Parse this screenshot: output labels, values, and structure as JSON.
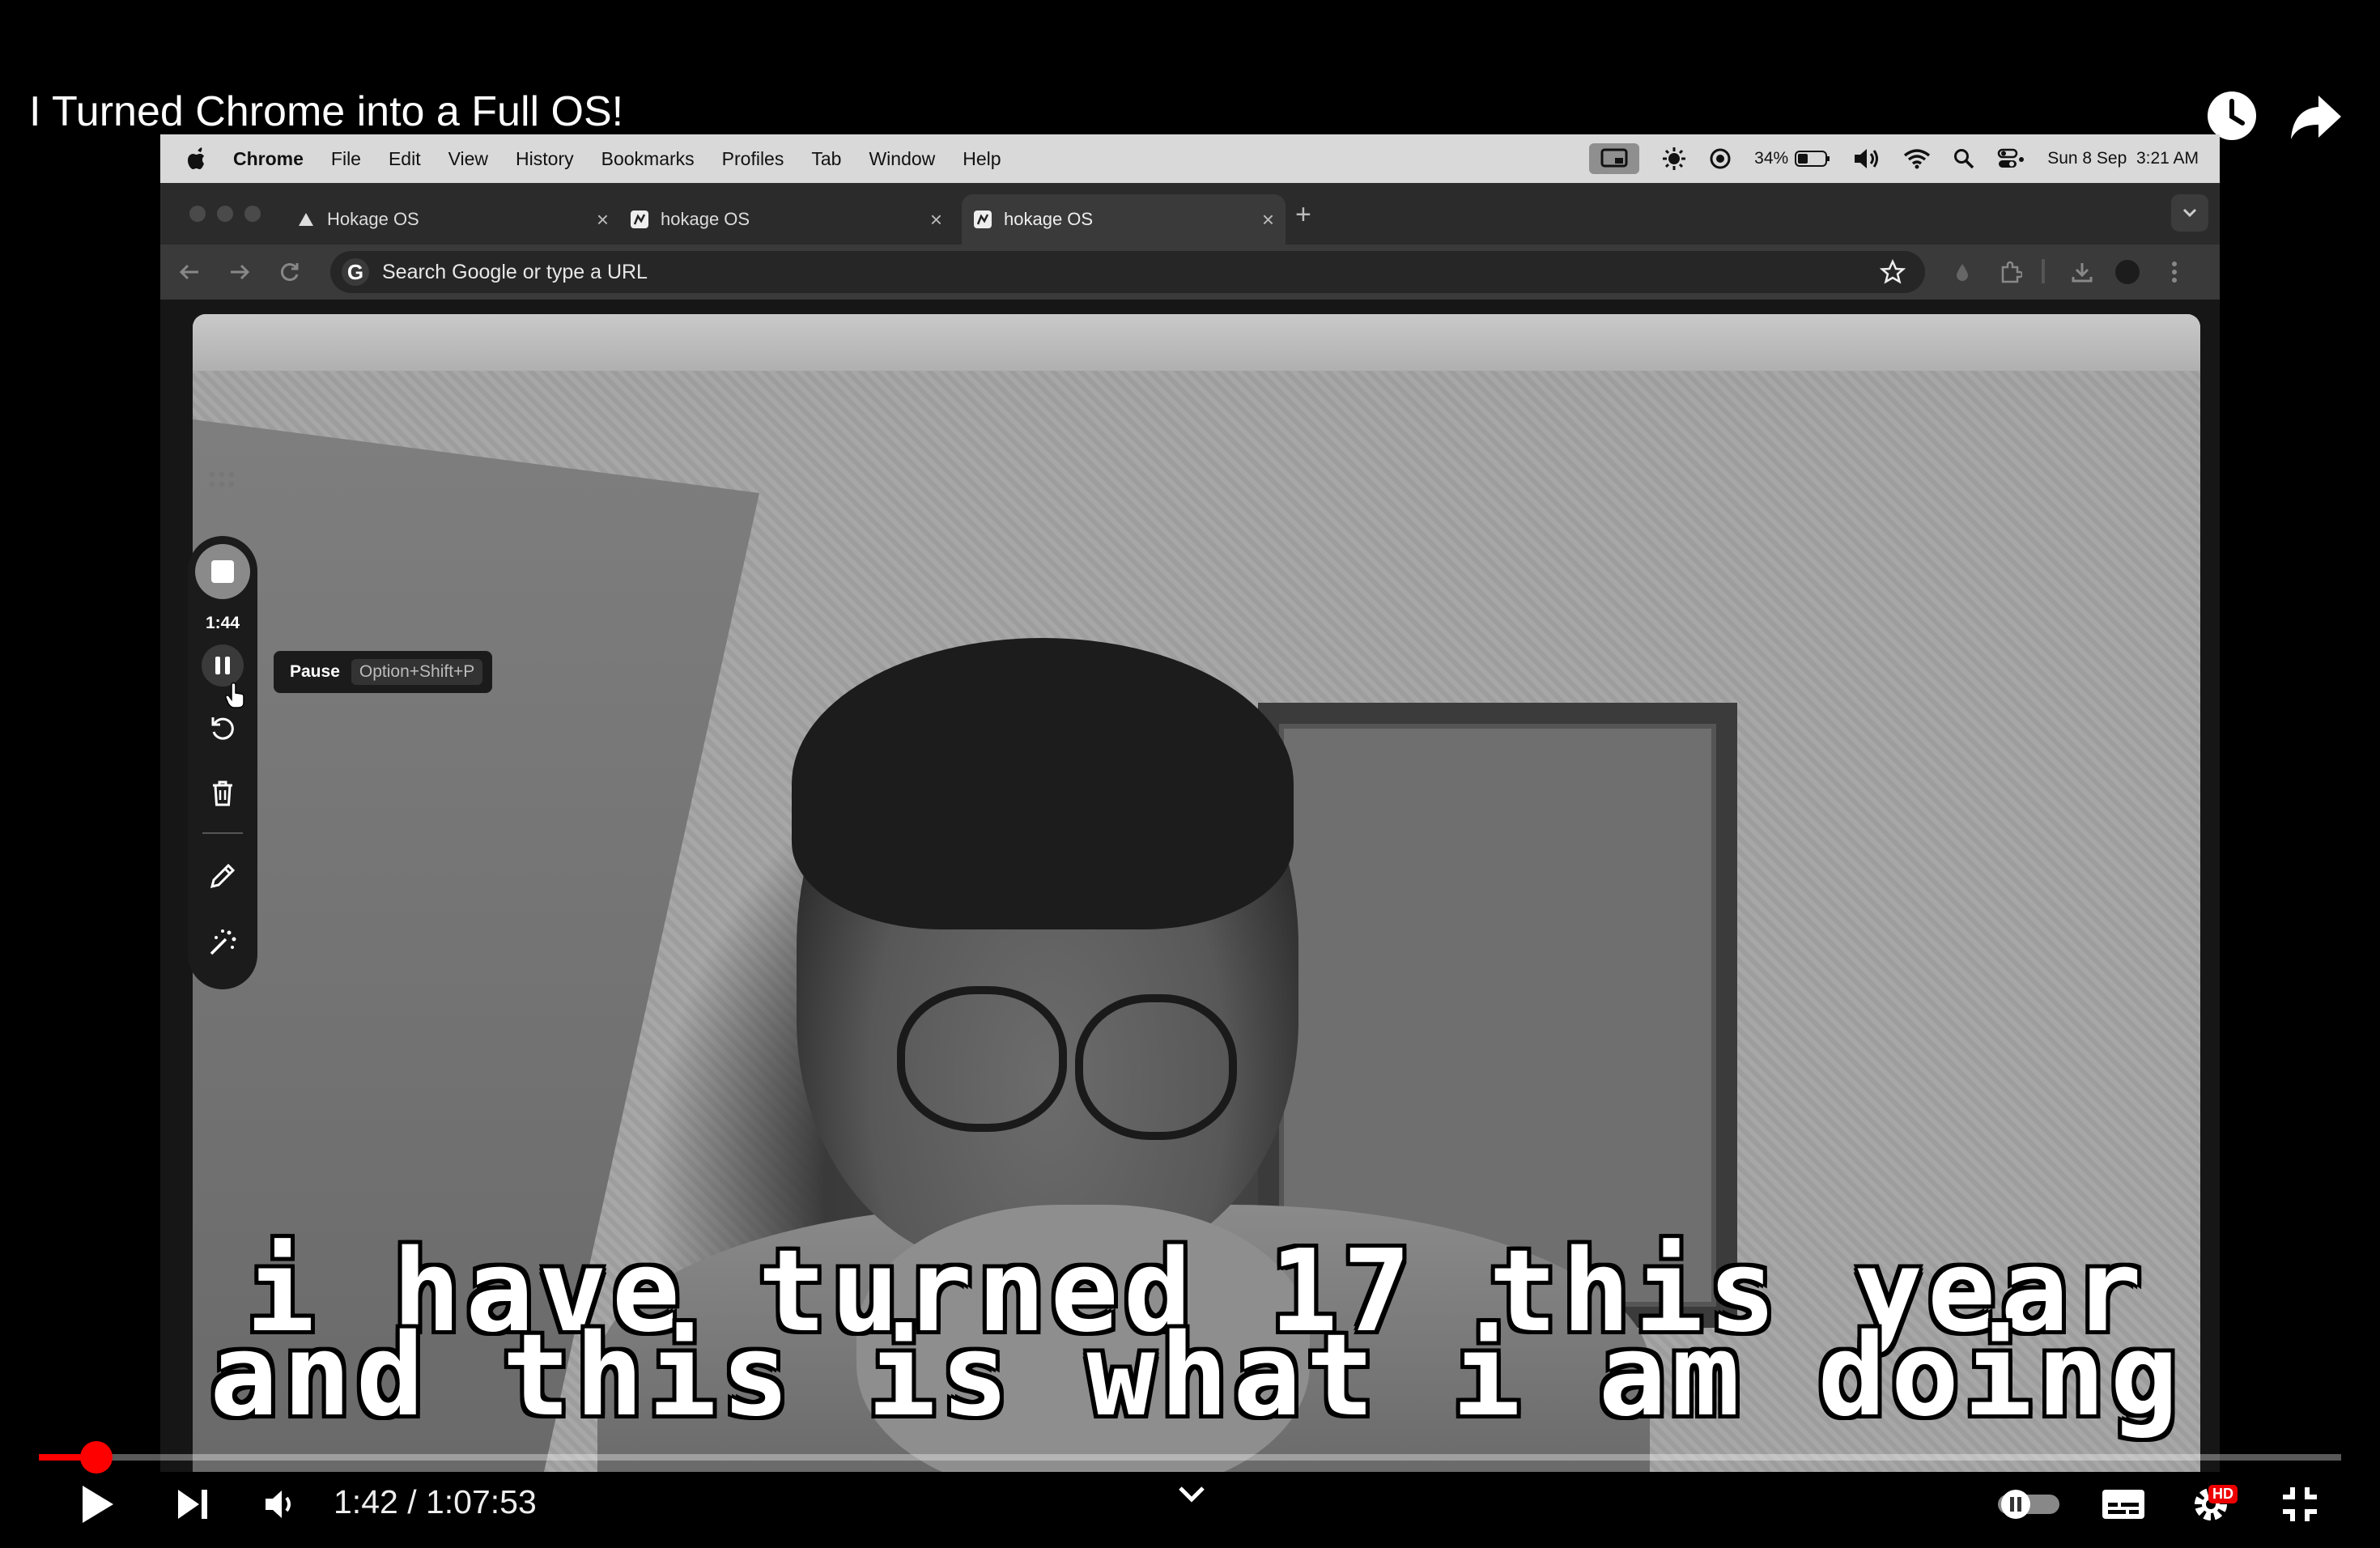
{
  "youtube": {
    "title": "I Turned Chrome into a Full OS!",
    "current_time": "1:42",
    "duration": "1:07:53",
    "time_display": "1:42 / 1:07:53",
    "progress_fraction": 0.0251,
    "quality_badge": "HD",
    "accent_color": "#ff0000",
    "icons": [
      "watch-later-icon",
      "share-icon",
      "play-icon",
      "next-icon",
      "volume-icon",
      "chevron-down-icon",
      "autoplay-toggle-icon",
      "captions-icon",
      "settings-icon",
      "exit-fullscreen-icon"
    ]
  },
  "mac_menubar": {
    "app": "Chrome",
    "items": [
      "File",
      "Edit",
      "View",
      "History",
      "Bookmarks",
      "Profiles",
      "Tab",
      "Window",
      "Help"
    ],
    "battery": "34%",
    "datetime": "Sun 8 Sep  3:21 AM"
  },
  "chrome": {
    "tabs": [
      {
        "title": "Hokage OS",
        "active": false
      },
      {
        "title": "hokage OS",
        "active": false
      },
      {
        "title": "hokage OS",
        "active": true
      }
    ],
    "omnibox_placeholder": "Search Google or type a URL"
  },
  "recorder": {
    "elapsed": "1:44",
    "tooltip_label": "Pause",
    "tooltip_shortcut": "Option+Shift+P"
  },
  "subtitles": {
    "line1": "i have turned 17 this year",
    "line2": "and this is what i am doing"
  }
}
